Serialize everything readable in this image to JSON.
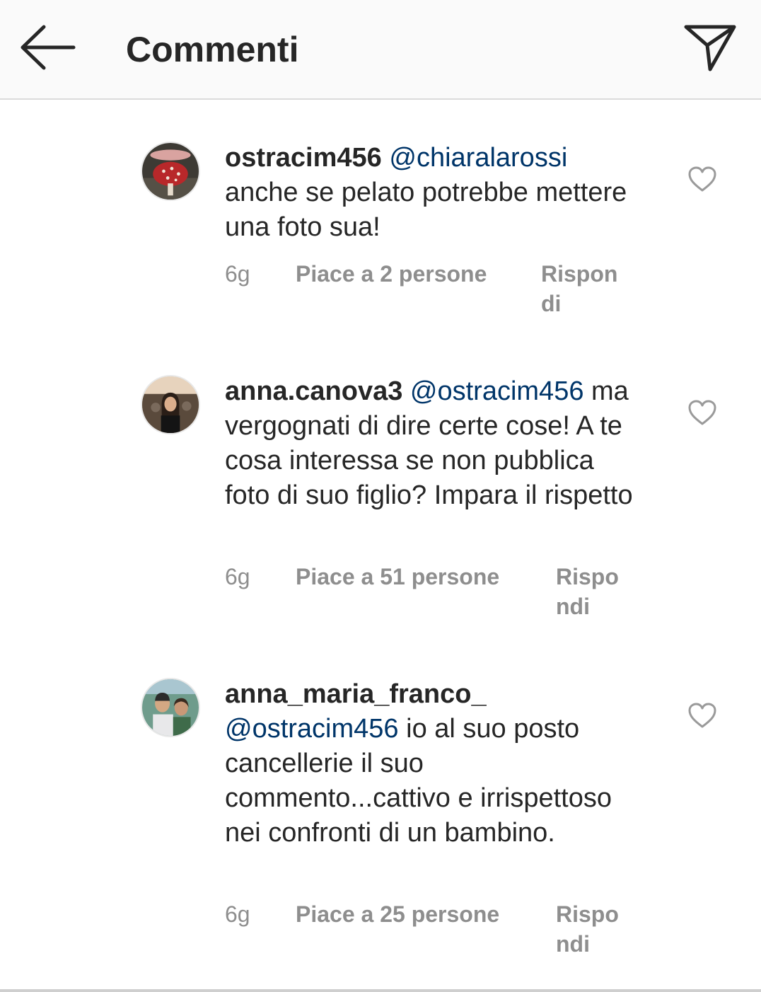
{
  "header": {
    "title": "Commenti"
  },
  "comments": [
    {
      "username": "ostracim456",
      "mention": "@chiaralarossi",
      "text": "anche se pelato potrebbe mettere una foto sua!",
      "time": "6g",
      "likes": "Piace a 2 persone",
      "reply": "Rispondi"
    },
    {
      "username": "anna.canova3",
      "mention": "@ostracim456",
      "text": "ma vergognati di dire certe cose! A te cosa interessa se non pubblica foto di suo figlio? Impara il rispetto",
      "time": "6g",
      "likes": "Piace a 51 persone",
      "reply": "Rispondi"
    },
    {
      "username": "anna_maria_franco_",
      "mention": "@ostracim456",
      "text": "io al suo posto cancellerie il suo commento...cattivo e irrispettoso nei confronti di un bambino.",
      "time": "6g",
      "likes": "Piace a 25 persone",
      "reply": "Rispondi"
    }
  ]
}
